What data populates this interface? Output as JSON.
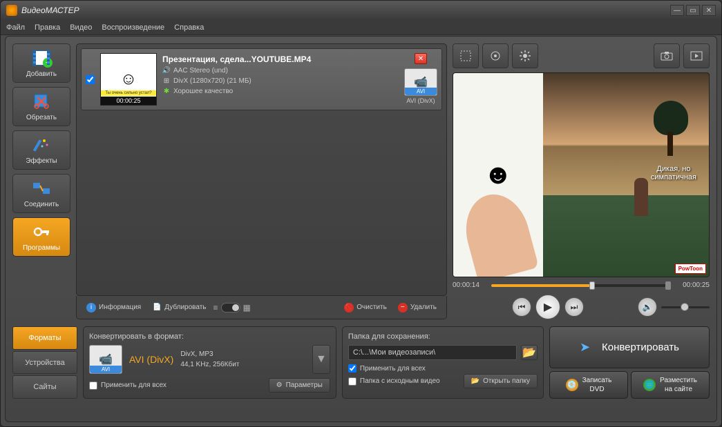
{
  "title": "ВидеоМАСТЕР",
  "menu": {
    "file": "Файл",
    "edit": "Правка",
    "video": "Видео",
    "playback": "Воспроизведение",
    "help": "Справка"
  },
  "sidebar": {
    "add": "Добавить",
    "trim": "Обрезать",
    "effects": "Эффекты",
    "join": "Соединить",
    "programs": "Программы"
  },
  "file": {
    "name": "Презентация, сдела...YOUTUBE.MP4",
    "audio": "AAC Stereo (und)",
    "video": "DivX (1280x720) (21 МБ)",
    "quality": "Хорошее качество",
    "timestamp": "00:00:25",
    "thumb_caption": "Ты очень сильно устал?",
    "out_tag": "AVI",
    "out_label": "AVI (DivX)"
  },
  "toolbar": {
    "info": "Информация",
    "dup": "Дублировать",
    "clear": "Очистить",
    "delete": "Удалить"
  },
  "preview": {
    "time_current": "00:00:14",
    "time_total": "00:00:25",
    "caption_line1": "Дикая, но",
    "caption_line2": "симпатичная",
    "logo": "PowToon"
  },
  "tabs": {
    "formats": "Форматы",
    "devices": "Устройства",
    "sites": "Сайты"
  },
  "format_panel": {
    "title": "Конвертировать в формат:",
    "icon_tag": "AVI",
    "name": "AVI (DivX)",
    "spec1": "DivX, MP3",
    "spec2": "44,1 KHz, 256Кбит",
    "apply_all": "Применить для всех",
    "params": "Параметры"
  },
  "save_panel": {
    "title": "Папка для сохранения:",
    "path": "C:\\...\\Мои видеозаписи\\",
    "apply_all": "Применить для всех",
    "source_folder": "Папка с исходным видео",
    "open_folder": "Открыть папку"
  },
  "actions": {
    "convert": "Конвертировать",
    "dvd": "Записать\nDVD",
    "publish": "Разместить\nна сайте"
  }
}
